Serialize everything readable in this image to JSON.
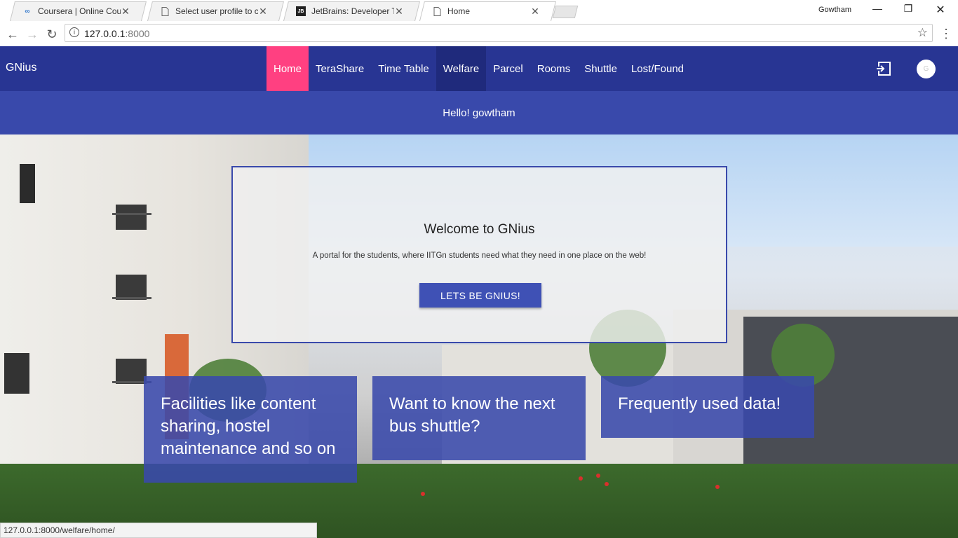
{
  "browser": {
    "tabs": [
      {
        "title": "Coursera | Online Course",
        "icon": "coursera-icon",
        "active": false
      },
      {
        "title": "Select user profile to cha",
        "icon": "page-icon",
        "active": false
      },
      {
        "title": "JetBrains: Developer Tool",
        "icon": "jetbrains-icon",
        "active": false
      },
      {
        "title": "Home",
        "icon": "page-icon",
        "active": true
      }
    ],
    "profile_name": "Gowtham",
    "url_host": "127.0.0.1",
    "url_port": ":8000",
    "status_url": "127.0.0.1:8000/welfare/home/"
  },
  "app": {
    "brand": "GNius",
    "nav": [
      {
        "label": "Home",
        "state": "active"
      },
      {
        "label": "TeraShare",
        "state": ""
      },
      {
        "label": "Time Table",
        "state": ""
      },
      {
        "label": "Welfare",
        "state": "hover"
      },
      {
        "label": "Parcel",
        "state": ""
      },
      {
        "label": "Rooms",
        "state": ""
      },
      {
        "label": "Shuttle",
        "state": ""
      },
      {
        "label": "Lost/Found",
        "state": ""
      }
    ],
    "avatar_initial": "G",
    "greeting": "Hello! gowtham",
    "colors": {
      "primary": "#283593",
      "accent": "#ff4081",
      "secondary": "#3949ab"
    }
  },
  "welcome": {
    "title": "Welcome to GNius",
    "subtitle": "A portal for the students, where IITGn students need what they need in one place on the web!",
    "cta": "LETS BE GNIUS!"
  },
  "cards": [
    {
      "text": "Facilities like content sharing, hostel maintenance and so on"
    },
    {
      "text": "Want to know the next bus shuttle?"
    },
    {
      "text": "Frequently used data!"
    }
  ]
}
